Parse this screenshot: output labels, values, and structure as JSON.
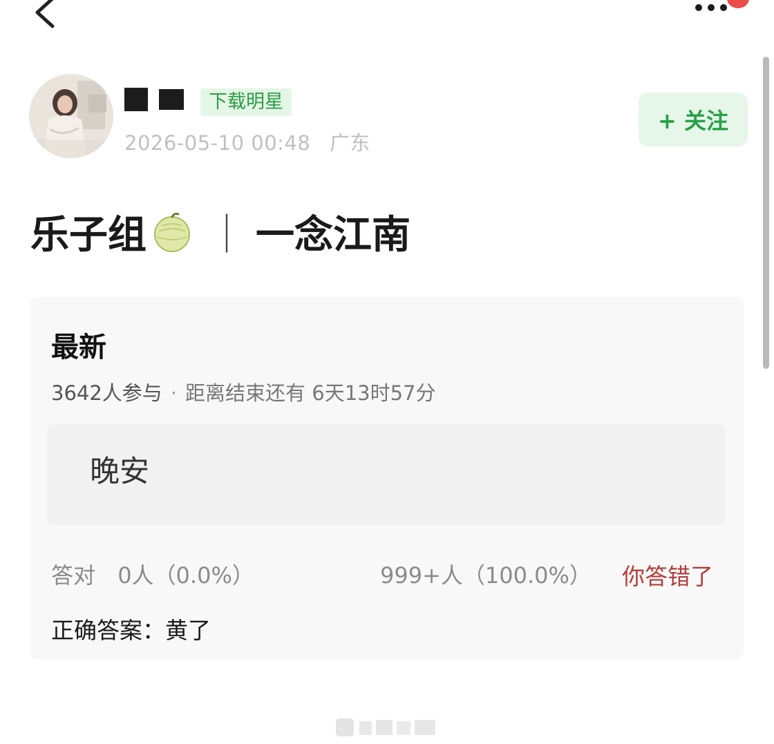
{
  "nav": {
    "back_icon": "chevron-left-icon",
    "more_icon": "more-dots-icon"
  },
  "author": {
    "name_redacted": true,
    "tag": "下载明星",
    "date": "2026-05-10 00:48",
    "location": "广东",
    "follow_label": "+ 关注"
  },
  "post": {
    "title_part1": "乐子组",
    "title_icon": "melon-icon",
    "title_separator": "｜",
    "title_part2": "一念江南"
  },
  "quiz": {
    "title": "最新",
    "participants": "3642人参与",
    "separator": "·",
    "countdown": "距离结束还有 6天13时57分",
    "user_answer": "晚安",
    "correct_label": "答对",
    "correct_count": "0人（0.0%）",
    "other_count": "999+人（100.0%）",
    "result": "你答错了",
    "answer_label": "正确答案：",
    "answer_value": "黄了"
  },
  "colors": {
    "accent_green": "#26a046",
    "tag_bg": "#e4f6e6",
    "wrong_red": "#b43c3c",
    "card_bg": "#f8f8f8"
  }
}
